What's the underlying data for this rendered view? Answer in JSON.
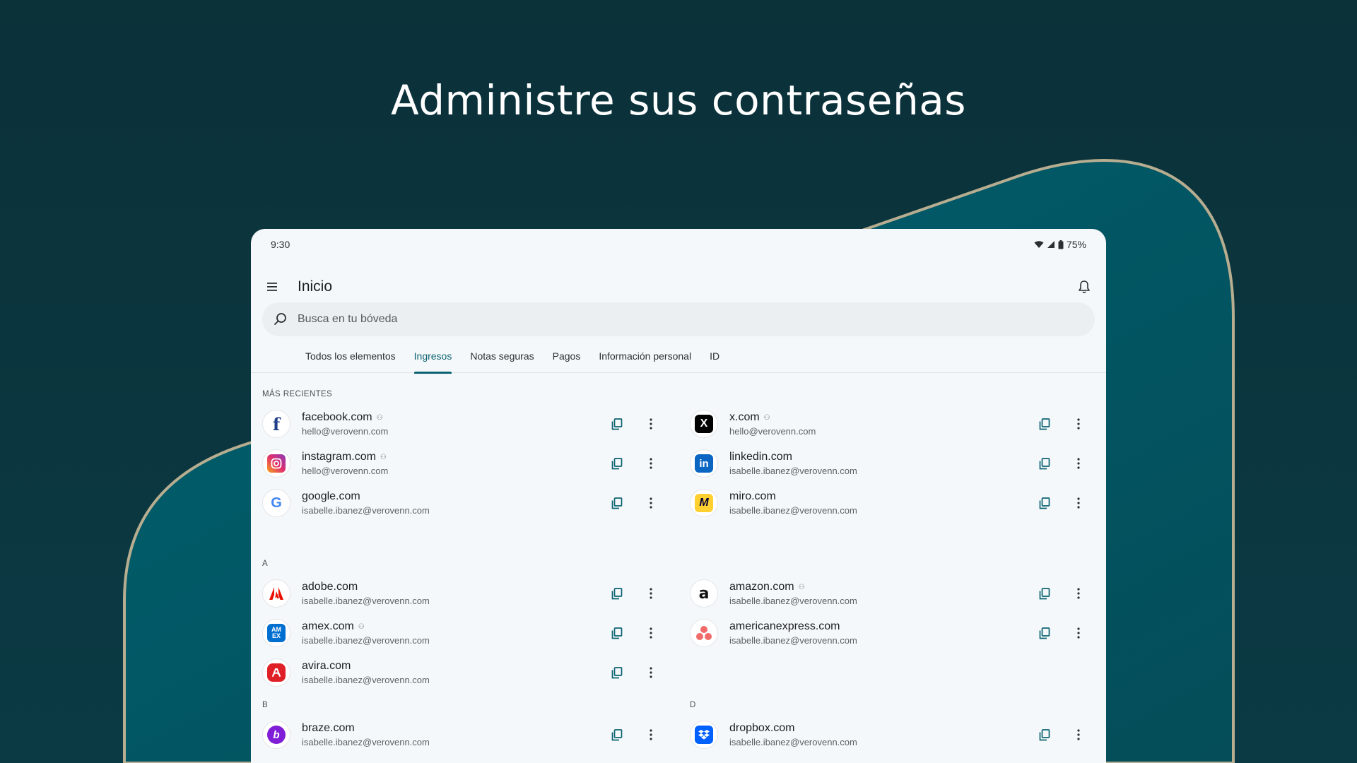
{
  "headline": "Administre sus contraseñas",
  "status": {
    "time": "9:30",
    "battery": "75%"
  },
  "appbar": {
    "title": "Inicio"
  },
  "search": {
    "placeholder": "Busca en tu bóveda"
  },
  "tabs": [
    {
      "label": "Todos los elementos",
      "active": false
    },
    {
      "label": "Ingresos",
      "active": true
    },
    {
      "label": "Notas seguras",
      "active": false
    },
    {
      "label": "Pagos",
      "active": false
    },
    {
      "label": "Información personal",
      "active": false
    },
    {
      "label": "ID",
      "active": false
    }
  ],
  "sections": {
    "recent": "MÁS RECIENTES",
    "a": "A",
    "b": "B",
    "d": "D"
  },
  "items": {
    "facebook": {
      "title": "facebook.com",
      "sub": "hello@verovenn.com",
      "shared": true
    },
    "x": {
      "title": "x.com",
      "sub": "hello@verovenn.com",
      "shared": true
    },
    "instagram": {
      "title": "instagram.com",
      "sub": "hello@verovenn.com",
      "shared": true
    },
    "linkedin": {
      "title": "linkedin.com",
      "sub": "isabelle.ibanez@verovenn.com",
      "shared": false
    },
    "google": {
      "title": "google.com",
      "sub": "isabelle.ibanez@verovenn.com",
      "shared": false
    },
    "miro": {
      "title": "miro.com",
      "sub": "isabelle.ibanez@verovenn.com",
      "shared": false
    },
    "adobe": {
      "title": "adobe.com",
      "sub": "isabelle.ibanez@verovenn.com",
      "shared": false
    },
    "amazon": {
      "title": "amazon.com",
      "sub": "isabelle.ibanez@verovenn.com",
      "shared": true
    },
    "amex": {
      "title": "amex.com",
      "sub": "isabelle.ibanez@verovenn.com",
      "shared": true
    },
    "americanexpress": {
      "title": "americanexpress.com",
      "sub": "isabelle.ibanez@verovenn.com",
      "shared": false
    },
    "avira": {
      "title": "avira.com",
      "sub": "isabelle.ibanez@verovenn.com",
      "shared": false
    },
    "braze": {
      "title": "braze.com",
      "sub": "isabelle.ibanez@verovenn.com",
      "shared": false
    },
    "dropbox": {
      "title": "dropbox.com",
      "sub": "isabelle.ibanez@verovenn.com",
      "shared": false
    }
  },
  "icons": {
    "menu": "menu-icon",
    "bell": "bell-icon",
    "search": "search-icon",
    "copy": "copy-icon",
    "more": "more-vert-icon",
    "shared": "collection-icon"
  },
  "colors": {
    "background": "#0b3139",
    "accent": "#0b6371",
    "shape_fill": "#035563",
    "shape_stroke": "#b7ad90",
    "surface": "#f5f8fa"
  }
}
